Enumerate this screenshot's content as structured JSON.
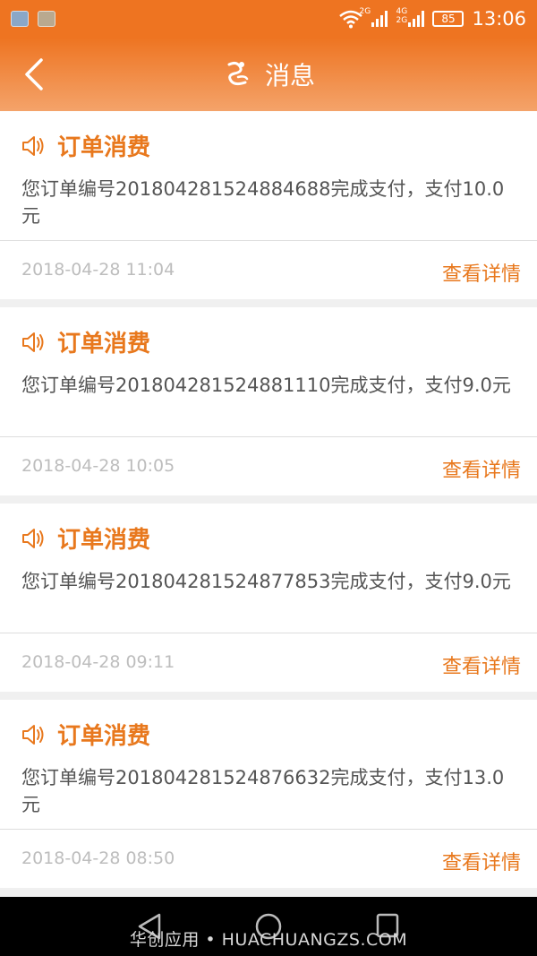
{
  "status_bar": {
    "net_label_1": "2G",
    "net_label_2a": "4G",
    "net_label_2b": "2G",
    "battery": "85",
    "time": "13:06"
  },
  "header": {
    "title": "消息",
    "back_icon": "chevron-left-icon",
    "logo_icon": "dragon-logo-icon"
  },
  "messages": [
    {
      "title": "订单消费",
      "body": "您订单编号201804281524884688完成支付，支付10.0元",
      "time": "2018-04-28 11:04",
      "action": "查看详情"
    },
    {
      "title": "订单消费",
      "body": "您订单编号201804281524881110完成支付，支付9.0元",
      "time": "2018-04-28 10:05",
      "action": "查看详情"
    },
    {
      "title": "订单消费",
      "body": "您订单编号201804281524877853完成支付，支付9.0元",
      "time": "2018-04-28 09:11",
      "action": "查看详情"
    },
    {
      "title": "订单消费",
      "body": "您订单编号201804281524876632完成支付，支付13.0元",
      "time": "2018-04-28 08:50",
      "action": "查看详情"
    }
  ],
  "watermark": "华创应用 • HUACHUANGZS.COM",
  "colors": {
    "accent": "#e8781d",
    "header_top": "#ee7421",
    "header_bottom": "#f4a36a"
  }
}
